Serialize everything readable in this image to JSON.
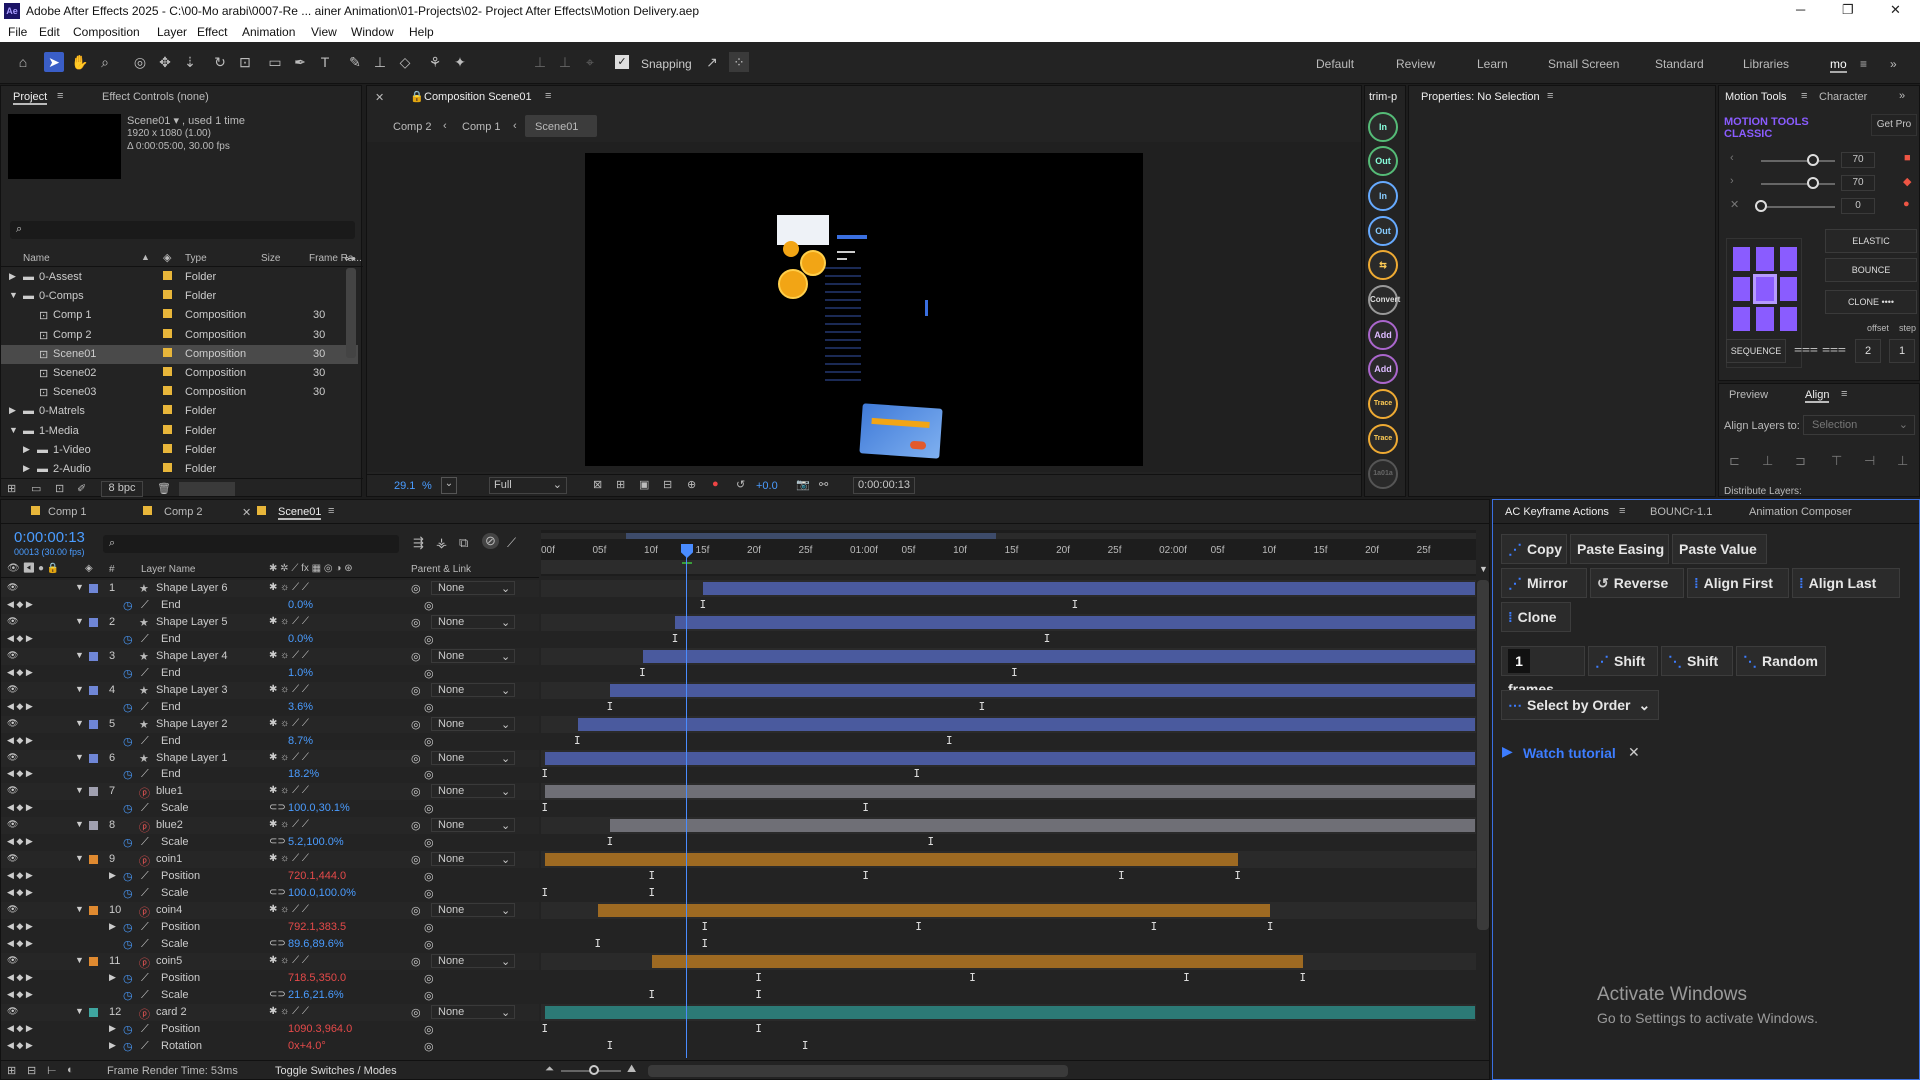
{
  "window": {
    "title": "Adobe After Effects 2025 - C:\\00-Mo arabi\\0007-Re ... ainer Animation\\01-Projects\\02- Project After Effects\\Motion Delivery.aep",
    "logo": "Ae"
  },
  "menu": [
    "File",
    "Edit",
    "Composition",
    "Layer",
    "Effect",
    "Animation",
    "View",
    "Window",
    "Help"
  ],
  "toolbar": {
    "snapping_label": "Snapping",
    "snapping_checked": true
  },
  "workspaces": [
    "Default",
    "Review",
    "Learn",
    "Small Screen",
    "Standard",
    "Libraries",
    "mo"
  ],
  "project": {
    "tab_label": "Project",
    "effect_controls_label": "Effect Controls (none)",
    "preview_name": "Scene01 ▾ , used 1 time",
    "preview_size": "1920 x 1080 (1.00)",
    "preview_duration": "Δ 0:00:05:00, 30.00 fps",
    "search_placeholder": "",
    "columns": {
      "name": "Name",
      "type": "Type",
      "size": "Size",
      "fps": "Frame Ra..."
    },
    "items": [
      {
        "name": "0-Assest",
        "type": "Folder",
        "fps": "",
        "level": 0,
        "expanded": false,
        "folder": true
      },
      {
        "name": "0-Comps",
        "type": "Folder",
        "fps": "",
        "level": 0,
        "expanded": true,
        "folder": true
      },
      {
        "name": "Comp 1",
        "type": "Composition",
        "fps": "30",
        "level": 1,
        "folder": false
      },
      {
        "name": "Comp 2",
        "type": "Composition",
        "fps": "30",
        "level": 1,
        "folder": false
      },
      {
        "name": "Scene01",
        "type": "Composition",
        "fps": "30",
        "level": 1,
        "folder": false,
        "selected": true
      },
      {
        "name": "Scene02",
        "type": "Composition",
        "fps": "30",
        "level": 1,
        "folder": false
      },
      {
        "name": "Scene03",
        "type": "Composition",
        "fps": "30",
        "level": 1,
        "folder": false
      },
      {
        "name": "0-Matrels",
        "type": "Folder",
        "fps": "",
        "level": 0,
        "expanded": false,
        "folder": true
      },
      {
        "name": "1-Media",
        "type": "Folder",
        "fps": "",
        "level": 0,
        "expanded": true,
        "folder": true
      },
      {
        "name": "1-Video",
        "type": "Folder",
        "fps": "",
        "level": 1,
        "expanded": false,
        "folder": true
      },
      {
        "name": "2-Audio",
        "type": "Folder",
        "fps": "",
        "level": 1,
        "expanded": false,
        "folder": true
      }
    ],
    "bpc": "8 bpc"
  },
  "composition": {
    "tab_label": "Composition Scene01",
    "breadcrumbs": [
      "Comp 2",
      "Comp 1",
      "Scene01"
    ],
    "zoom": "29.1",
    "zoom_unit": "%",
    "resolution": "Full",
    "exposure": "+0.0",
    "timecode": "0:00:00:13"
  },
  "right_strip": {
    "label": "trim-p",
    "buttons": [
      "In",
      "Out",
      "In",
      "Out",
      "",
      "Convert",
      "Add",
      "Add",
      "Trace In",
      "Trace Out",
      "1a01a"
    ]
  },
  "properties": {
    "title": "Properties: No Selection"
  },
  "motion_tools": {
    "tabs": [
      "Motion Tools",
      "Character"
    ],
    "title_line1": "MOTION TOOLS",
    "title_line2": "CLASSIC",
    "get_pro": "Get Pro",
    "sliders": [
      {
        "value": "70",
        "level": 0.7
      },
      {
        "value": "70",
        "level": 0.7
      },
      {
        "value": "0",
        "level": 0.0
      }
    ],
    "buttons": [
      "ELASTIC",
      "BOUNCE",
      "CLONE ••••"
    ],
    "offset_label": "offset",
    "step_label": "step",
    "sequence_label": "SEQUENCE",
    "offset_value": "2",
    "step_value": "1",
    "accent": "#8a5cff"
  },
  "align": {
    "tabs": [
      "Preview",
      "Align"
    ],
    "align_to_label": "Align Layers to:",
    "align_to_value": "Selection",
    "distribute_label": "Distribute Layers:"
  },
  "timeline": {
    "tabs": [
      "Comp 1",
      "Comp 2",
      "Scene01"
    ],
    "timecode": "0:00:00:13",
    "sub_timecode": "00013 (30.00 fps)",
    "columns": {
      "num": "#",
      "layer": "Layer Name",
      "parent": "Parent & Link"
    },
    "ruler": [
      "00f",
      "05f",
      "10f",
      "15f",
      "20f",
      "25f",
      "01:00f",
      "05f",
      "10f",
      "15f",
      "20f",
      "25f",
      "02:00f",
      "05f",
      "10f",
      "15f",
      "20f",
      "25f"
    ],
    "rows": [
      {
        "kind": "layer",
        "num": "1",
        "name": "Shape Layer 6",
        "parent": "None",
        "color": "#6f86d6",
        "icon": "★",
        "bar_start": 0.17,
        "bar_end": 1.0,
        "bar_color": "#4a5a9e"
      },
      {
        "kind": "prop",
        "name": "End",
        "value": "0.0%",
        "kfs": [
          0.17,
          0.57
        ]
      },
      {
        "kind": "layer",
        "num": "2",
        "name": "Shape Layer 5",
        "parent": "None",
        "color": "#6f86d6",
        "icon": "★",
        "bar_start": 0.14,
        "bar_end": 1.0,
        "bar_color": "#4a5a9e"
      },
      {
        "kind": "prop",
        "name": "End",
        "value": "0.0%",
        "kfs": [
          0.14,
          0.54
        ]
      },
      {
        "kind": "layer",
        "num": "3",
        "name": "Shape Layer 4",
        "parent": "None",
        "color": "#6f86d6",
        "icon": "★",
        "bar_start": 0.105,
        "bar_end": 1.0,
        "bar_color": "#4a5a9e"
      },
      {
        "kind": "prop",
        "name": "End",
        "value": "1.0%",
        "kfs": [
          0.105,
          0.505
        ]
      },
      {
        "kind": "layer",
        "num": "4",
        "name": "Shape Layer 3",
        "parent": "None",
        "color": "#6f86d6",
        "icon": "★",
        "bar_start": 0.07,
        "bar_end": 1.0,
        "bar_color": "#4a5a9e"
      },
      {
        "kind": "prop",
        "name": "End",
        "value": "3.6%",
        "kfs": [
          0.07,
          0.47
        ]
      },
      {
        "kind": "layer",
        "num": "5",
        "name": "Shape Layer 2",
        "parent": "None",
        "color": "#6f86d6",
        "icon": "★",
        "bar_start": 0.035,
        "bar_end": 1.0,
        "bar_color": "#4a5a9e"
      },
      {
        "kind": "prop",
        "name": "End",
        "value": "8.7%",
        "kfs": [
          0.035,
          0.435
        ]
      },
      {
        "kind": "layer",
        "num": "6",
        "name": "Shape Layer 1",
        "parent": "None",
        "color": "#6f86d6",
        "icon": "★",
        "bar_start": 0.0,
        "bar_end": 1.0,
        "bar_color": "#4a5a9e"
      },
      {
        "kind": "prop",
        "name": "End",
        "value": "18.2%",
        "kfs": [
          0.0,
          0.4
        ]
      },
      {
        "kind": "layer",
        "num": "7",
        "name": "blue1",
        "parent": "None",
        "color": "#a0a0b0",
        "icon": "ⓟ",
        "bar_start": 0.0,
        "bar_end": 1.0,
        "bar_color": "#6f6f76"
      },
      {
        "kind": "prop",
        "name": "Scale",
        "value": "100.0,30.1%",
        "kfs": [
          0.0,
          0.345
        ]
      },
      {
        "kind": "layer",
        "num": "8",
        "name": "blue2",
        "parent": "None",
        "color": "#a0a0b0",
        "icon": "ⓟ",
        "bar_start": 0.07,
        "bar_end": 1.0,
        "bar_color": "#6f6f76"
      },
      {
        "kind": "prop",
        "name": "Scale",
        "value": "5.2,100.0%",
        "kfs": [
          0.07,
          0.415
        ]
      },
      {
        "kind": "layer",
        "num": "9",
        "name": "coin1",
        "parent": "None",
        "color": "#e08a30",
        "icon": "ⓟ",
        "bar_start": 0.0,
        "bar_end": 0.745,
        "bar_color": "#9e6a22"
      },
      {
        "kind": "prop",
        "name": "Position",
        "value": "720.1,444.0",
        "red": true,
        "kfs": [
          0.115,
          0.345,
          0.62,
          0.745
        ]
      },
      {
        "kind": "prop",
        "name": "Scale",
        "value": "100.0,100.0%",
        "kfs": [
          0.0,
          0.115
        ]
      },
      {
        "kind": "layer",
        "num": "10",
        "name": "coin4",
        "parent": "None",
        "color": "#e08a30",
        "icon": "ⓟ",
        "bar_start": 0.057,
        "bar_end": 0.78,
        "bar_color": "#9e6a22"
      },
      {
        "kind": "prop",
        "name": "Position",
        "value": "792.1,383.5",
        "red": true,
        "kfs": [
          0.172,
          0.402,
          0.655,
          0.78
        ]
      },
      {
        "kind": "prop",
        "name": "Scale",
        "value": "89.6,89.6%",
        "kfs": [
          0.057,
          0.172
        ]
      },
      {
        "kind": "layer",
        "num": "11",
        "name": "coin5",
        "parent": "None",
        "color": "#e08a30",
        "icon": "ⓟ",
        "bar_start": 0.115,
        "bar_end": 0.815,
        "bar_color": "#9e6a22"
      },
      {
        "kind": "prop",
        "name": "Position",
        "value": "718.5,350.0",
        "red": true,
        "kfs": [
          0.23,
          0.46,
          0.69,
          0.815
        ]
      },
      {
        "kind": "prop",
        "name": "Scale",
        "value": "21.6,21.6%",
        "kfs": [
          0.115,
          0.23
        ]
      },
      {
        "kind": "layer",
        "num": "12",
        "name": "card 2",
        "parent": "None",
        "color": "#3fa6a0",
        "icon": "ⓟ",
        "bar_start": 0.0,
        "bar_end": 1.0,
        "bar_color": "#2c7a76"
      },
      {
        "kind": "prop",
        "name": "Position",
        "value": "1090.3,964.0",
        "red": true,
        "kfs": [
          0.0,
          0.23
        ]
      },
      {
        "kind": "prop",
        "name": "Rotation",
        "value": "0x+4.0°",
        "red": true,
        "kfs": [
          0.07,
          0.28
        ]
      }
    ],
    "footer_render_time": "Frame Render Time: 53ms",
    "footer_toggle": "Toggle Switches / Modes"
  },
  "ac_panel": {
    "tabs": [
      "AC Keyframe Actions",
      "BOUNCr-1.1",
      "Animation Composer"
    ],
    "row1": [
      "Copy",
      "Paste Easing",
      "Paste Value"
    ],
    "row2": [
      "Mirror",
      "Reverse",
      "Align First",
      "Align Last"
    ],
    "row3": [
      "Clone"
    ],
    "frames_value": "1",
    "frames_label": "frames",
    "row4": [
      "Shift",
      "Shift",
      "Random"
    ],
    "select_by_order": "Select by Order",
    "watch_tutorial": "Watch tutorial",
    "activate_title": "Activate Windows",
    "activate_sub": "Go to Settings to activate Windows."
  },
  "colors": {
    "accent_blue": "#3a6fe0",
    "playhead": "#4a8cff",
    "timecode_blue": "#4a9cff"
  }
}
